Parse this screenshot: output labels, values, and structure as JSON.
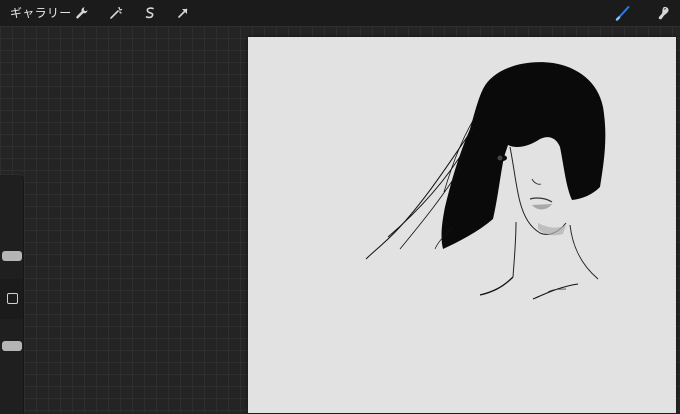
{
  "topbar": {
    "gallery_label": "ギャラリー",
    "tools_left": [
      {
        "name": "wrench-icon",
        "action": "actions"
      },
      {
        "name": "magic-wand-icon",
        "action": "adjustments"
      },
      {
        "name": "selection-s-icon",
        "action": "selection"
      },
      {
        "name": "arrow-cursor-icon",
        "action": "transform"
      }
    ],
    "tools_right": [
      {
        "name": "brush-icon",
        "action": "paint",
        "color": "#2f7de1"
      },
      {
        "name": "smudge-icon",
        "action": "smudge"
      }
    ]
  },
  "sidebar": {
    "brush_size_slider": "brush-size",
    "modify_button": "modify",
    "opacity_slider": "brush-opacity"
  },
  "colors": {
    "topbar_bg": "#1b1b1b",
    "workspace_bg": "#242424",
    "canvas_bg": "#e2e2e2",
    "accent": "#2f7de1"
  }
}
